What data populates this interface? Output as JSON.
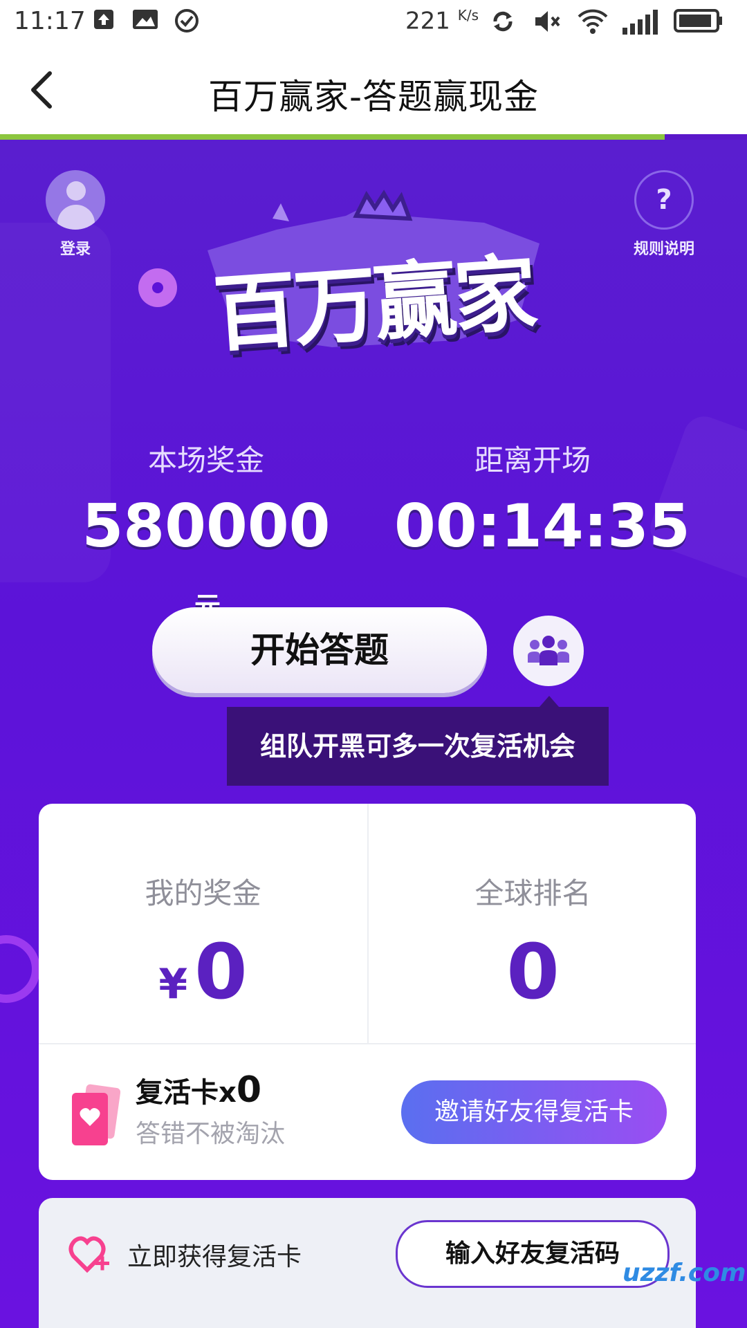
{
  "status_bar": {
    "time": "11:17",
    "speed": "221",
    "speed_unit": "K/s"
  },
  "header": {
    "title": "百万赢家-答题赢现金",
    "progress": 0.89,
    "progress_color": "#8cc63f"
  },
  "top": {
    "login_label": "登录",
    "rules_label": "规则说明",
    "rules_icon": "?",
    "logo_text": "百万赢家"
  },
  "stats": {
    "prize_label": "本场奖金",
    "prize_value": "580000",
    "prize_unit": "元",
    "countdown_label": "距离开场",
    "countdown_value": "00:14:35"
  },
  "actions": {
    "start_label": "开始答题",
    "tooltip": "组队开黑可多一次复活机会"
  },
  "card": {
    "my_prize_label": "我的奖金",
    "currency": "¥",
    "my_prize_value": "0",
    "ranking_label": "全球排名",
    "ranking_value": "0",
    "revive_title": "复活卡x",
    "revive_count": "0",
    "revive_sub": "答错不被淘汰",
    "invite_label": "邀请好友得复活卡"
  },
  "bottom": {
    "get_label": "立即获得复活卡",
    "code_label": "输入好友复活码"
  },
  "watermark": "uzzf.com",
  "colors": {
    "primary": "#5c13d8",
    "accent_purple": "#5b21c0",
    "tooltip_bg": "#3a1178",
    "card_bg": "#ffffff"
  }
}
